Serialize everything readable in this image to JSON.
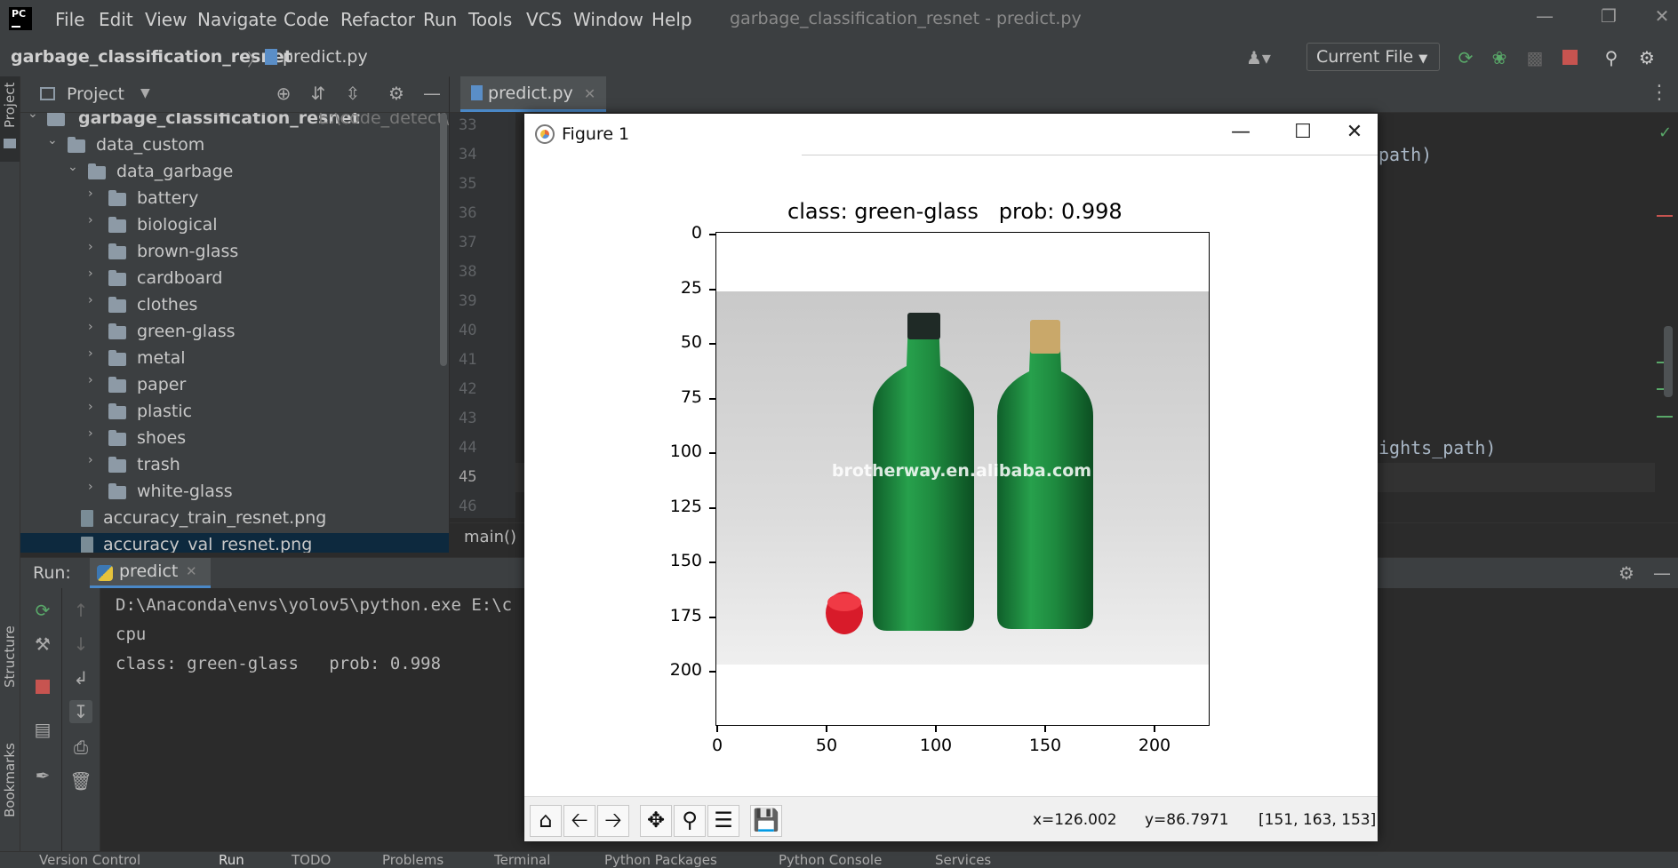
{
  "app": {
    "logo_text": "PC",
    "menu": [
      "File",
      "Edit",
      "View",
      "Navigate",
      "Code",
      "Refactor",
      "Run",
      "Tools",
      "VCS",
      "Window",
      "Help"
    ],
    "window_title": "garbage_classification_resnet - predict.py"
  },
  "navbar": {
    "project": "garbage_classification_resnet",
    "separator": "〉",
    "file": "predict.py",
    "run_config": "Current File"
  },
  "left_stripe": {
    "project": "Project",
    "structure": "Structure",
    "bookmarks": "Bookmarks"
  },
  "project_panel": {
    "title": "Project",
    "root": {
      "name": "garbage_classification_resnet",
      "path_hint": "E:\\code_detect\\W"
    },
    "data_custom": "data_custom",
    "data_garbage": "data_garbage",
    "folders": [
      "battery",
      "biological",
      "brown-glass",
      "cardboard",
      "clothes",
      "green-glass",
      "metal",
      "paper",
      "plastic",
      "shoes",
      "trash",
      "white-glass"
    ],
    "files": [
      "accuracy_train_resnet.png",
      "accuracy_val_resnet.png"
    ]
  },
  "editor": {
    "tab": "predict.py",
    "line_numbers": [
      "33",
      "34",
      "35",
      "36",
      "37",
      "38",
      "39",
      "40",
      "41",
      "42",
      "43",
      "44",
      "45",
      "46"
    ],
    "visible_code": {
      "line34": "path)",
      "line44": "ights_path)"
    },
    "breadcrumb": "main()"
  },
  "run_panel": {
    "label": "Run:",
    "tab": "predict",
    "console": [
      "D:\\Anaconda\\envs\\yolov5\\python.exe E:\\c",
      "cpu",
      "class: green-glass   prob: 0.998"
    ]
  },
  "bottom_tools": [
    "Version Control",
    "Run",
    "TODO",
    "Problems",
    "Terminal",
    "Python Packages",
    "Python Console",
    "Services"
  ],
  "figure": {
    "window_title": "Figure 1",
    "plot_title": "class: green-glass   prob: 0.998",
    "image_caption": "brotherway.en.alibaba.com",
    "y_ticks": [
      "0",
      "25",
      "50",
      "75",
      "100",
      "125",
      "150",
      "175",
      "200"
    ],
    "x_ticks": [
      "0",
      "50",
      "100",
      "150",
      "200"
    ],
    "status": {
      "x": "x=126.002",
      "y": "y=86.7971",
      "rgb": "[151, 163, 153]"
    }
  },
  "colors": {
    "accent": "#4a88c7",
    "run_green": "#59a869",
    "stop_red": "#c75450",
    "bottle_green": "#1f8a3e",
    "cap_red": "#d81b2a"
  }
}
